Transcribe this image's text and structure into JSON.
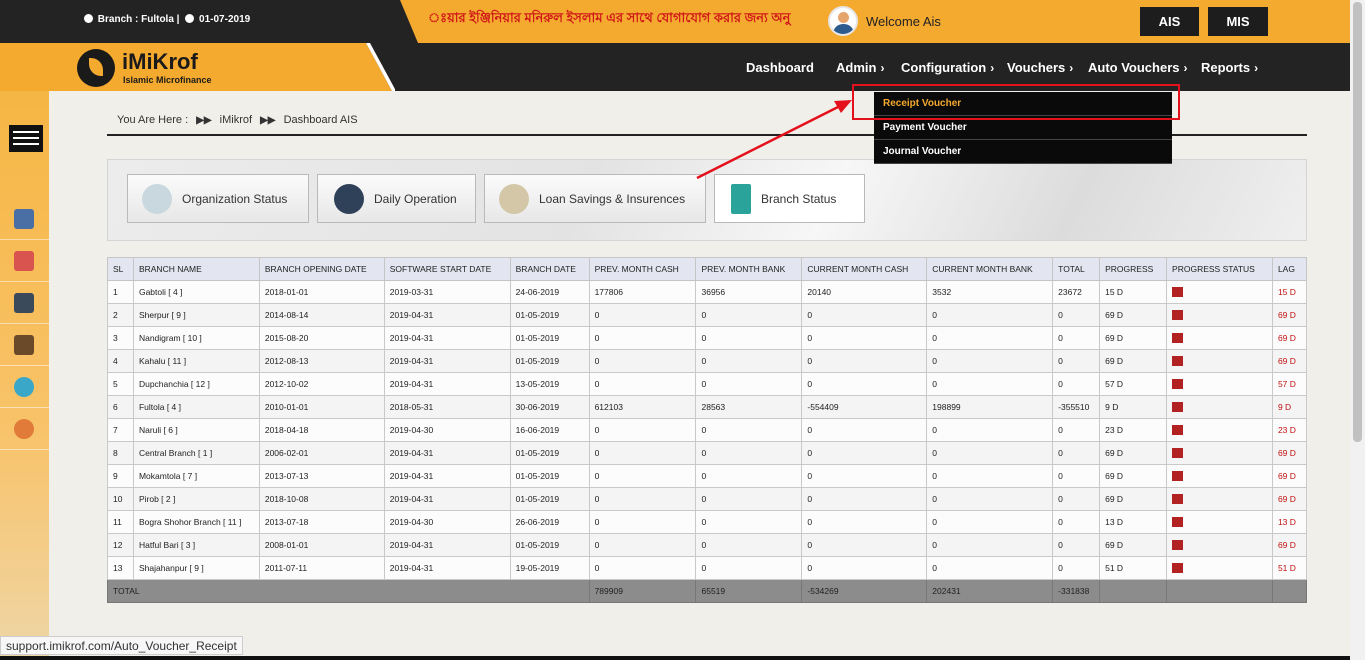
{
  "topbar": {
    "branch_text": "Branch : Fultola |",
    "date_text": "01-07-2019",
    "marquee": "ঃয়ার ইঞ্জিনিয়ার মনিরুল ইসলাম এর সাথে যোগাযোগ করার জন্য অনু",
    "welcome": "Welcome Ais",
    "ais_label": "AIS",
    "mis_label": "MIS"
  },
  "logo": {
    "title": "iMiKrof",
    "subtitle": "Islamic Microfinance"
  },
  "nav": {
    "dashboard": "Dashboard",
    "admin": "Admin",
    "configuration": "Configuration",
    "vouchers": "Vouchers",
    "auto_vouchers": "Auto Vouchers",
    "reports": "Reports",
    "arrow": "›"
  },
  "dropdown": [
    "Receipt Voucher",
    "Payment Voucher",
    "Journal Voucher"
  ],
  "breadcrumb": {
    "lead": "You Are Here  :",
    "sep": "▶▶",
    "item1": "iMikrof",
    "item2": "Dashboard AIS"
  },
  "tabs": [
    "Organization Status",
    "Daily Operation",
    "Loan Savings & Insurences",
    "Branch Status"
  ],
  "table": {
    "headers": [
      "SL",
      "BRANCH NAME",
      "BRANCH OPENING DATE",
      "SOFTWARE START DATE",
      "BRANCH DATE",
      "PREV. MONTH CASH",
      "PREV. MONTH BANK",
      "CURRENT MONTH CASH",
      "CURRENT MONTH BANK",
      "TOTAL",
      "PROGRESS",
      "PROGRESS STATUS",
      "LAG"
    ],
    "rows": [
      [
        "1",
        "Gabtoli [ 4 ]",
        "2018-01-01",
        "2019-03-31",
        "24-06-2019",
        "177806",
        "36956",
        "20140",
        "3532",
        "23672",
        "15 D",
        "",
        "15 D"
      ],
      [
        "2",
        "Sherpur [ 9 ]",
        "2014-08-14",
        "2019-04-31",
        "01-05-2019",
        "0",
        "0",
        "0",
        "0",
        "0",
        "69 D",
        "",
        "69 D"
      ],
      [
        "3",
        "Nandigram [ 10 ]",
        "2015-08-20",
        "2019-04-31",
        "01-05-2019",
        "0",
        "0",
        "0",
        "0",
        "0",
        "69 D",
        "",
        "69 D"
      ],
      [
        "4",
        "Kahalu [ 11 ]",
        "2012-08-13",
        "2019-04-31",
        "01-05-2019",
        "0",
        "0",
        "0",
        "0",
        "0",
        "69 D",
        "",
        "69 D"
      ],
      [
        "5",
        "Dupchanchia [ 12 ]",
        "2012-10-02",
        "2019-04-31",
        "13-05-2019",
        "0",
        "0",
        "0",
        "0",
        "0",
        "57 D",
        "",
        "57 D"
      ],
      [
        "6",
        "Fultola [ 4 ]",
        "2010-01-01",
        "2018-05-31",
        "30-06-2019",
        "612103",
        "28563",
        "-554409",
        "198899",
        "-355510",
        "9 D",
        "",
        "9 D"
      ],
      [
        "7",
        "Naruli [ 6 ]",
        "2018-04-18",
        "2019-04-30",
        "16-06-2019",
        "0",
        "0",
        "0",
        "0",
        "0",
        "23 D",
        "",
        "23 D"
      ],
      [
        "8",
        "Central Branch [ 1 ]",
        "2006-02-01",
        "2019-04-31",
        "01-05-2019",
        "0",
        "0",
        "0",
        "0",
        "0",
        "69 D",
        "",
        "69 D"
      ],
      [
        "9",
        "Mokamtola [ 7 ]",
        "2013-07-13",
        "2019-04-31",
        "01-05-2019",
        "0",
        "0",
        "0",
        "0",
        "0",
        "69 D",
        "",
        "69 D"
      ],
      [
        "10",
        "Pirob [ 2 ]",
        "2018-10-08",
        "2019-04-31",
        "01-05-2019",
        "0",
        "0",
        "0",
        "0",
        "0",
        "69 D",
        "",
        "69 D"
      ],
      [
        "11",
        "Bogra Shohor Branch [ 11 ]",
        "2013-07-18",
        "2019-04-30",
        "26-06-2019",
        "0",
        "0",
        "0",
        "0",
        "0",
        "13 D",
        "",
        "13 D"
      ],
      [
        "12",
        "Hatful Bari [ 3 ]",
        "2008-01-01",
        "2019-04-31",
        "01-05-2019",
        "0",
        "0",
        "0",
        "0",
        "0",
        "69 D",
        "",
        "69 D"
      ],
      [
        "13",
        "Shajahanpur [ 9 ]",
        "2011-07-11",
        "2019-04-31",
        "19-05-2019",
        "0",
        "0",
        "0",
        "0",
        "0",
        "51 D",
        "",
        "51 D"
      ]
    ],
    "total": {
      "label": "TOTAL",
      "prev_cash": "789909",
      "prev_bank": "65519",
      "cur_cash": "-534269",
      "cur_bank": "202431",
      "total": "-331838"
    }
  },
  "statusbar": "support.imikrof.com/Auto_Voucher_Receipt",
  "colors": {
    "accent": "#f4a92f",
    "dark": "#232323",
    "highlight": "#e4111c",
    "status": "#b22222"
  }
}
